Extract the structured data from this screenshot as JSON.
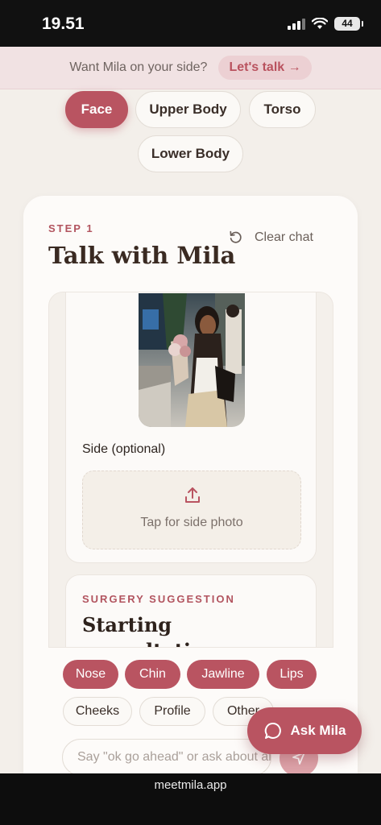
{
  "status_bar": {
    "time": "19.51",
    "battery": "44"
  },
  "promo": {
    "text": "Want Mila on your side?",
    "cta": "Let's talk →"
  },
  "body_areas": [
    {
      "label": "Face",
      "active": true
    },
    {
      "label": "Upper Body",
      "active": false
    },
    {
      "label": "Torso",
      "active": false
    },
    {
      "label": "Lower Body",
      "active": false
    }
  ],
  "step": {
    "label": "STEP 1",
    "title": "Talk with Mila",
    "clear_label": "Clear chat"
  },
  "photo_card": {
    "side_label": "Side (optional)",
    "upload_text": "Tap for side photo"
  },
  "suggestion": {
    "label": "SURGERY SUGGESTION",
    "title_line1": "Starting",
    "title_line2": "consultation"
  },
  "tags": [
    {
      "label": "Nose",
      "selected": true
    },
    {
      "label": "Chin",
      "selected": true
    },
    {
      "label": "Jawline",
      "selected": true
    },
    {
      "label": "Lips",
      "selected": true
    },
    {
      "label": "Cheeks",
      "selected": false
    },
    {
      "label": "Profile",
      "selected": false
    },
    {
      "label": "Other",
      "selected": false
    }
  ],
  "composer": {
    "placeholder": "Say \"ok go ahead\" or ask about anything"
  },
  "fab": {
    "label": "Ask Mila"
  },
  "browser": {
    "url": "meetmila.app"
  },
  "colors": {
    "accent": "#b95461",
    "background": "#f3efea",
    "promo_bg": "#f1e2e3"
  }
}
